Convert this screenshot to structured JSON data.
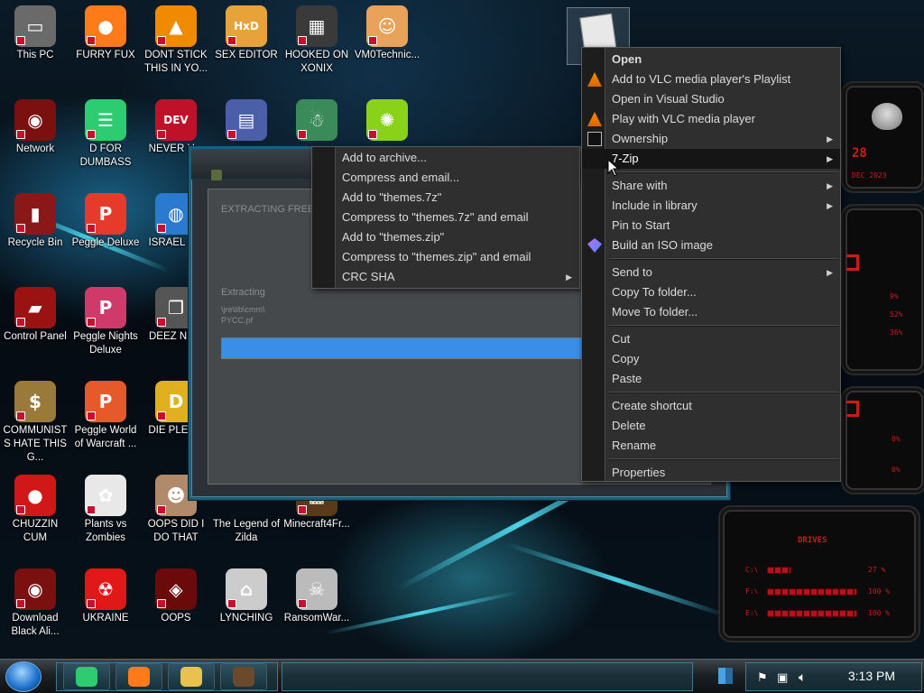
{
  "desktop_icons": [
    {
      "label": "This PC",
      "icon": "computer-icon",
      "color": "#6a6a6a"
    },
    {
      "label": "FURRY FUX",
      "icon": "firefox-icon",
      "color": "#ff7a18"
    },
    {
      "label": "DONT STICK THIS IN YO...",
      "icon": "vlc-cone-icon",
      "color": "#f08a00"
    },
    {
      "label": "SEX EDITOR",
      "icon": "hxd-editor-icon",
      "color": "#e7a33a"
    },
    {
      "label": "HOOKED ON XONIX",
      "icon": "maze-game-icon",
      "color": "#3a3a3a"
    },
    {
      "label": "VM0Technic...",
      "icon": "doctor-avatar-icon",
      "color": "#e8a25a"
    },
    {
      "label": "Network",
      "icon": "alien-network-icon",
      "color": "#7a1010"
    },
    {
      "label": "D FOR DUMBASS",
      "icon": "chat-bubble-icon",
      "color": "#2ecc71"
    },
    {
      "label": "NEVER U...",
      "icon": "dev-cpp-icon",
      "color": "#c0112a"
    },
    {
      "label": "",
      "icon": "card-icon",
      "color": "#4b5ea8"
    },
    {
      "label": "",
      "icon": "santa-face-icon",
      "color": "#3a8a5a"
    },
    {
      "label": "",
      "icon": "lime-icon",
      "color": "#8ad11a"
    },
    {
      "label": "Recycle Bin",
      "icon": "recycle-bin-icon",
      "color": "#8a1818"
    },
    {
      "label": "Peggle Deluxe",
      "icon": "peggle-icon",
      "color": "#e63a2a"
    },
    {
      "label": "ISRAEL S...",
      "icon": "network-globe-icon",
      "color": "#2a7ad0"
    },
    {
      "label": "Control Panel",
      "icon": "control-panel-icon",
      "color": "#9a1212"
    },
    {
      "label": "Peggle Nights Deluxe",
      "icon": "peggle-icon",
      "color": "#d03a6a"
    },
    {
      "label": "DEEZ NU...",
      "icon": "stacked-windows-icon",
      "color": "#555555"
    },
    {
      "label": "COMMUNISTS HATE THIS G...",
      "icon": "money-bag-icon",
      "color": "#9a7a3a"
    },
    {
      "label": "Peggle World of Warcraft ...",
      "icon": "peggle-icon",
      "color": "#e6592a"
    },
    {
      "label": "DIE PLEA...",
      "icon": "dex-icon",
      "color": "#e0b020"
    },
    {
      "label": "CHUZZIN CUM",
      "icon": "chuzzle-icon",
      "color": "#d01818"
    },
    {
      "label": "Plants vs Zombies",
      "icon": "flower-icon",
      "color": "#e8e8e8"
    },
    {
      "label": "OOPS DID I DO THAT",
      "icon": "portrait-icon",
      "color": "#b08a6a"
    },
    {
      "label": "The Legend of Zilda",
      "icon": "",
      "color": "#000000"
    },
    {
      "label": "Minecraft4Fr...",
      "icon": "grass-block-icon",
      "color": "#5a3a1a"
    },
    {
      "label": "Download Black Ali...",
      "icon": "alien-network-icon",
      "color": "#7a1010"
    },
    {
      "label": "UKRAINE",
      "icon": "radiation-icon",
      "color": "#e01818"
    },
    {
      "label": "OOPS",
      "icon": "alien-app-icon",
      "color": "#6a0a0a"
    },
    {
      "label": "LYNCHING",
      "icon": "lynching-icon",
      "color": "#cccccc"
    },
    {
      "label": "RansomWar...",
      "icon": "skull-icon",
      "color": "#bbbbbb"
    }
  ],
  "dialog": {
    "status": "EXTRACTING FREE",
    "label": "Extracting",
    "path_line1": "\\jre\\lib\\cmm\\",
    "path_line2": "PYCC.pf",
    "progress_percent": 100,
    "progress_color": "#3a8ee6"
  },
  "context_menu": {
    "items": [
      {
        "label": "Open",
        "bold": true
      },
      {
        "label": "Add to VLC media player's Playlist",
        "icon": "vlc-cone-icon"
      },
      {
        "label": "Open in Visual Studio"
      },
      {
        "label": "Play with VLC media player",
        "icon": "vlc-cone-icon"
      },
      {
        "label": "Ownership",
        "arrow": true,
        "icon": "console-icon"
      },
      {
        "label": "7-Zip",
        "arrow": true,
        "highlight": true
      },
      {
        "separator": true
      },
      {
        "label": "Share with",
        "arrow": true
      },
      {
        "label": "Include in library",
        "arrow": true
      },
      {
        "label": "Pin to Start"
      },
      {
        "label": "Build an ISO image",
        "icon": "gem-icon"
      },
      {
        "separator": true
      },
      {
        "label": "Send to",
        "arrow": true
      },
      {
        "label": "Copy To folder..."
      },
      {
        "label": "Move To folder..."
      },
      {
        "separator": true
      },
      {
        "label": "Cut"
      },
      {
        "label": "Copy"
      },
      {
        "label": "Paste"
      },
      {
        "separator": true
      },
      {
        "label": "Create shortcut"
      },
      {
        "label": "Delete"
      },
      {
        "label": "Rename"
      },
      {
        "separator": true
      },
      {
        "label": "Properties"
      }
    ]
  },
  "zip_submenu": {
    "items": [
      {
        "label": "Add to archive..."
      },
      {
        "label": "Compress and email..."
      },
      {
        "label": "Add to \"themes.7z\""
      },
      {
        "label": "Compress to \"themes.7z\" and email"
      },
      {
        "label": "Add to \"themes.zip\""
      },
      {
        "label": "Compress to \"themes.zip\" and email"
      },
      {
        "label": "CRC SHA",
        "arrow": true
      }
    ]
  },
  "widgets": {
    "clock_digits": "28",
    "date_text": "DEC 2023",
    "cpu_values": [
      "9%",
      "52%",
      "36%"
    ],
    "net_values": [
      "0%",
      "0%"
    ],
    "drives_title": "DRIVES",
    "drives": [
      {
        "label": "C:\\",
        "value": "27 %",
        "fill": 0.27
      },
      {
        "label": "F:\\",
        "value": "100 %",
        "fill": 1.0
      },
      {
        "label": "E:\\",
        "value": "100 %",
        "fill": 1.0
      }
    ]
  },
  "taskbar": {
    "clock": "3:13 PM",
    "pinned": [
      "chat-bubble-icon",
      "firefox-icon",
      "folder-icon",
      "grass-block-icon"
    ],
    "tray": [
      "flag-icon",
      "network-icon",
      "volume-icon"
    ]
  },
  "colors": {
    "accent_blue": "#3a8ee6",
    "alien_red": "#d01a1a",
    "menu_bg": "#2f2f2f"
  }
}
